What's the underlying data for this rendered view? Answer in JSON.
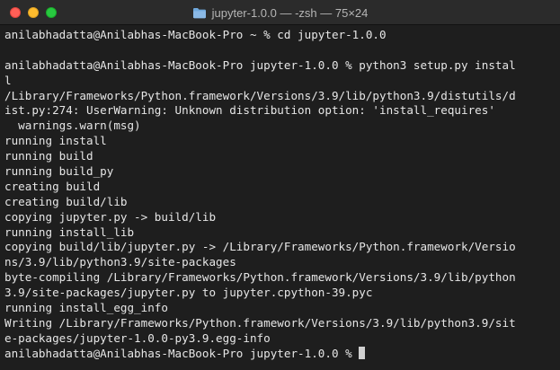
{
  "window": {
    "title": "jupyter-1.0.0 — -zsh — 75×24"
  },
  "terminal": {
    "lines": [
      "anilabhadatta@Anilabhas-MacBook-Pro ~ % cd jupyter-1.0.0",
      "",
      "anilabhadatta@Anilabhas-MacBook-Pro jupyter-1.0.0 % python3 setup.py instal",
      "l",
      "/Library/Frameworks/Python.framework/Versions/3.9/lib/python3.9/distutils/d",
      "ist.py:274: UserWarning: Unknown distribution option: 'install_requires'",
      "  warnings.warn(msg)",
      "running install",
      "running build",
      "running build_py",
      "creating build",
      "creating build/lib",
      "copying jupyter.py -> build/lib",
      "running install_lib",
      "copying build/lib/jupyter.py -> /Library/Frameworks/Python.framework/Versio",
      "ns/3.9/lib/python3.9/site-packages",
      "byte-compiling /Library/Frameworks/Python.framework/Versions/3.9/lib/python",
      "3.9/site-packages/jupyter.py to jupyter.cpython-39.pyc",
      "running install_egg_info",
      "Writing /Library/Frameworks/Python.framework/Versions/3.9/lib/python3.9/sit",
      "e-packages/jupyter-1.0.0-py3.9.egg-info"
    ],
    "prompt": "anilabhadatta@Anilabhas-MacBook-Pro jupyter-1.0.0 % "
  }
}
